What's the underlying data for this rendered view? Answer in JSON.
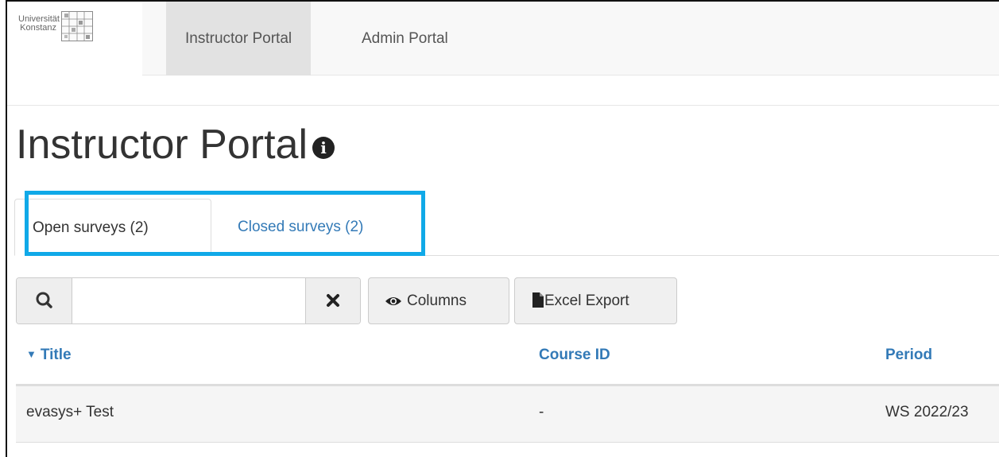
{
  "brand": {
    "line1": "Universität",
    "line2": "Konstanz",
    "logo_icon": "university-seal-icon"
  },
  "nav": {
    "items": [
      {
        "label": "Instructor Portal",
        "active": true
      },
      {
        "label": "Admin Portal",
        "active": false
      }
    ]
  },
  "page": {
    "title": "Instructor Portal",
    "info_icon": "info-icon"
  },
  "tabs": [
    {
      "label": "Open surveys (2)",
      "active": true
    },
    {
      "label": "Closed surveys (2)",
      "active": false
    }
  ],
  "toolbar": {
    "search_value": "",
    "search_icon": "search-icon",
    "clear_icon": "close-icon",
    "columns_label": "Columns",
    "columns_icon": "eye-icon",
    "excel_label": "Excel Export",
    "excel_icon": "file-icon"
  },
  "table": {
    "sort_indicator": "▼",
    "columns": [
      "Title",
      "Course ID",
      "Period"
    ],
    "rows": [
      {
        "title": "evasys+ Test",
        "course_id": "-",
        "period": "WS 2022/23"
      }
    ]
  },
  "colors": {
    "link": "#337ab7",
    "highlight": "#10a9e8",
    "nav_active": "#e2e2e2"
  }
}
